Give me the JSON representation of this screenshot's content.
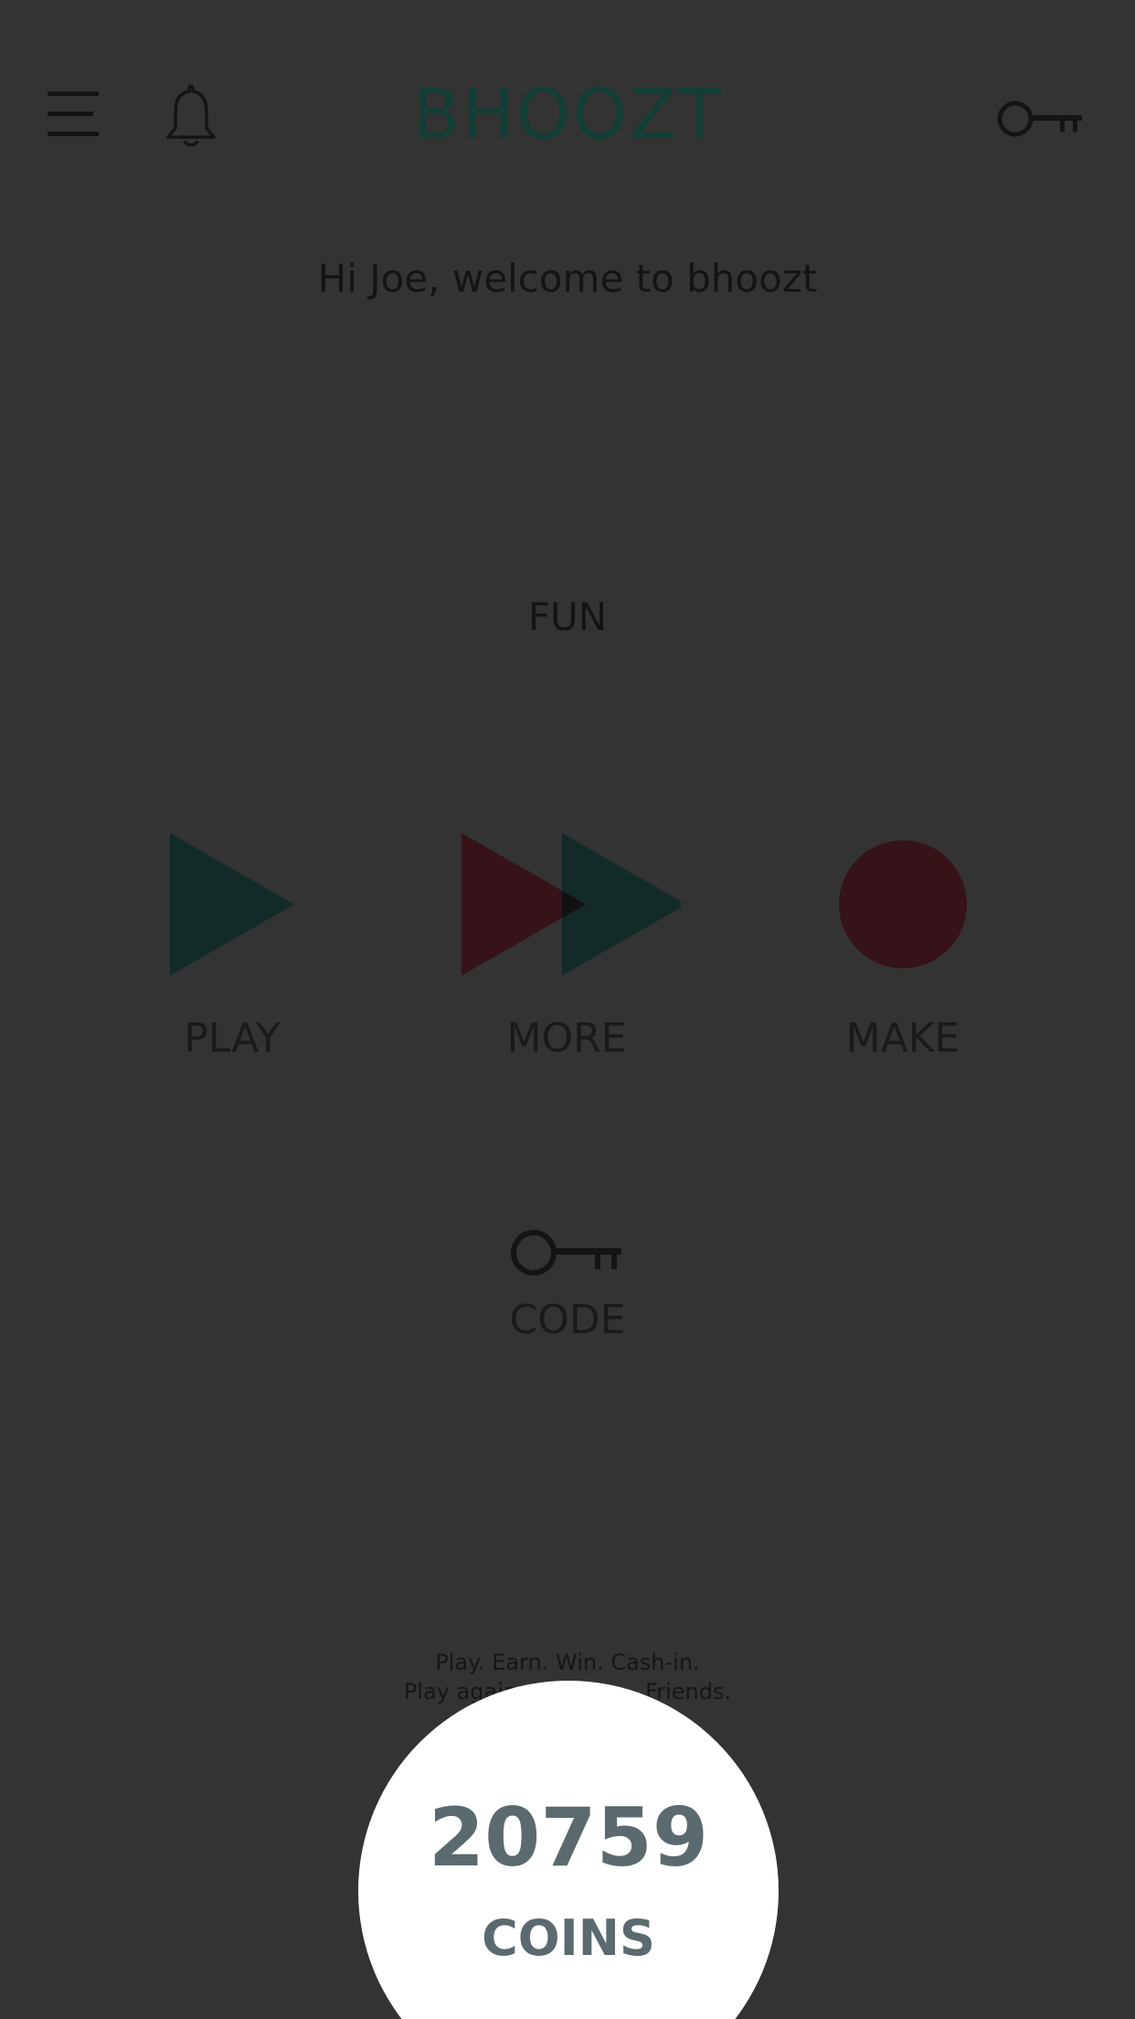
{
  "header": {
    "brand": "BHOOZT",
    "menu_icon": "hamburger-menu-icon",
    "notification_icon": "bell-icon",
    "code_icon": "key-icon"
  },
  "welcome": "Hi Joe, welcome to bhoozt",
  "section_title": "FUN",
  "actions": {
    "play": {
      "label": "PLAY",
      "icon": "play-triangle-icon"
    },
    "more": {
      "label": "MORE",
      "icon": "double-triangle-icon"
    },
    "make": {
      "label": "MAKE",
      "icon": "record-circle-icon"
    }
  },
  "code": {
    "label": "CODE",
    "icon": "key-icon"
  },
  "footer": {
    "tagline_line1": "Play. Earn. Win. Cash-in.",
    "tagline_line2": "Play again",
    "tagline_line2_end": "Friends."
  },
  "coins": {
    "value": "20759",
    "label": "COINS"
  },
  "colors": {
    "background": "#333333",
    "brand": "#133e36",
    "accent_green": "#132b28",
    "accent_red": "#361219",
    "coins_text": "#5a6a6f"
  }
}
